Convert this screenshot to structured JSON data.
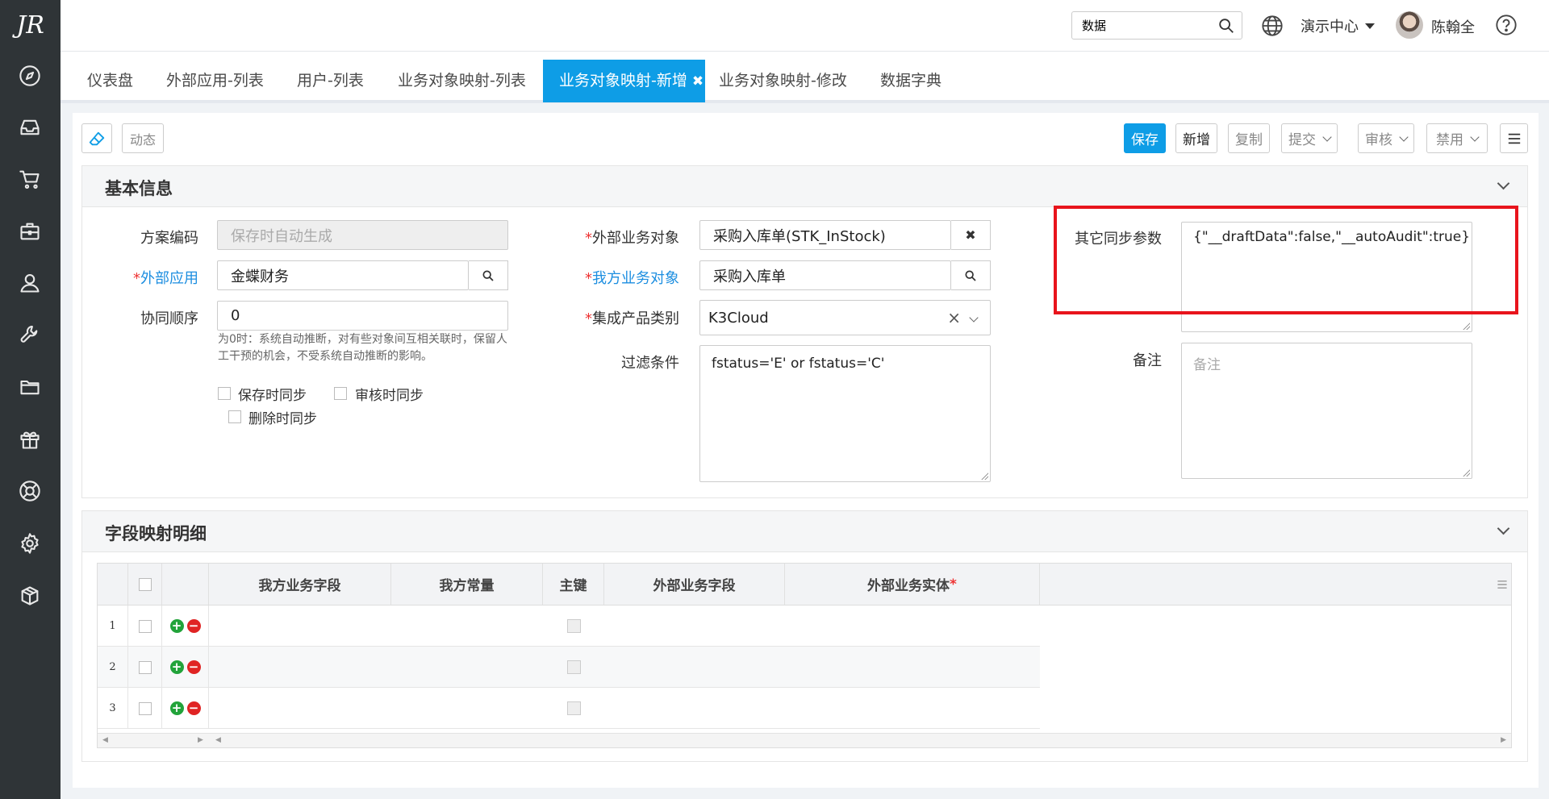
{
  "sidebar": {
    "logo": "JR",
    "icons": [
      "compass-icon",
      "inbox-icon",
      "cart-icon",
      "briefcase-icon",
      "user-icon",
      "wrench-icon",
      "folder-icon",
      "gift-icon",
      "lifebuoy-icon",
      "gear-icon",
      "cube-icon"
    ]
  },
  "header": {
    "search_value": "数据",
    "org": "演示中心",
    "user": "陈翰全"
  },
  "tabs": [
    {
      "label": "仪表盘",
      "active": false
    },
    {
      "label": "外部应用-列表",
      "active": false
    },
    {
      "label": "用户-列表",
      "active": false
    },
    {
      "label": "业务对象映射-列表",
      "active": false
    },
    {
      "label": "业务对象映射-新增",
      "active": true,
      "close": "✖"
    },
    {
      "label": "业务对象映射-修改",
      "active": false
    },
    {
      "label": "数据字典",
      "active": false
    }
  ],
  "toolbar": {
    "dynamic": "动态",
    "save": "保存",
    "new": "新增",
    "copy": "复制",
    "submit": "提交",
    "audit": "审核",
    "disable": "禁用"
  },
  "basic": {
    "title": "基本信息",
    "scheme_code_label": "方案编码",
    "scheme_code_placeholder": "保存时自动生成",
    "ext_app_label": "外部应用",
    "ext_app_value": "金蝶财务",
    "order_label": "协同顺序",
    "order_value": "0",
    "order_hint": "为0时：系统自动推断，对有些对象间互相关联时，保留人工干预的机会，不受系统自动推断的影响。",
    "cb_save_sync": "保存时同步",
    "cb_audit_sync": "审核时同步",
    "cb_delete_sync": "删除时同步",
    "ext_obj_label": "外部业务对象",
    "ext_obj_value": "采购入库单(STK_InStock)",
    "my_obj_label": "我方业务对象",
    "my_obj_value": "采购入库单",
    "product_label": "集成产品类别",
    "product_value": "K3Cloud",
    "filter_label": "过滤条件",
    "filter_value": "fstatus='E' or fstatus='C'",
    "other_params_label": "其它同步参数",
    "other_params_value": "{\"__draftData\":false,\"__autoAudit\":true}",
    "remark_label": "备注",
    "remark_placeholder": "备注"
  },
  "mapping": {
    "title": "字段映射明细",
    "columns": [
      "我方业务字段",
      "我方常量",
      "主键",
      "外部业务字段",
      "外部业务实体"
    ],
    "rows": [
      "1",
      "2",
      "3"
    ]
  }
}
